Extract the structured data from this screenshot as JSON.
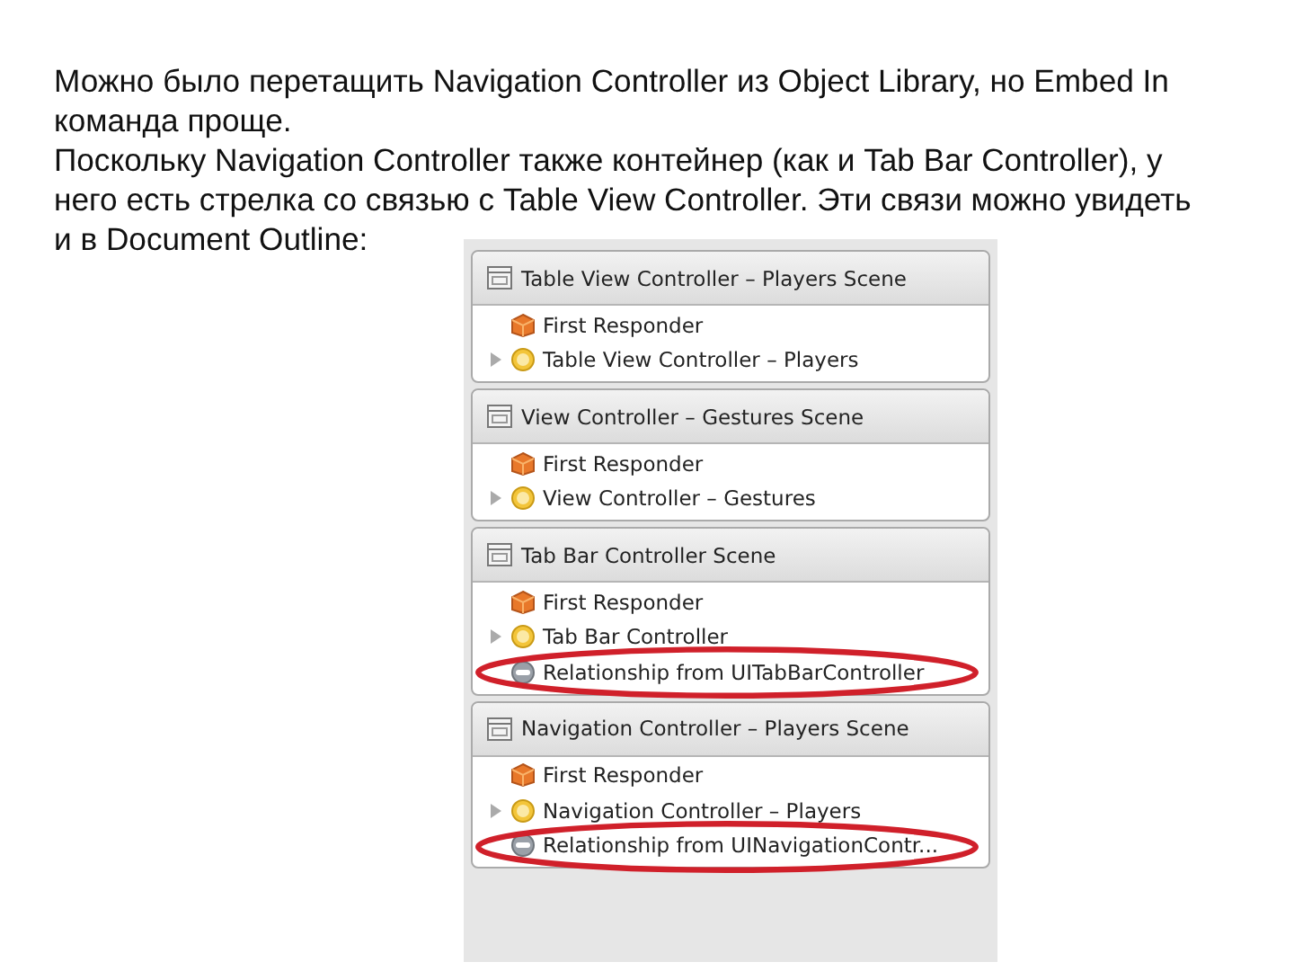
{
  "paragraphs": [
    "Можно было перетащить Navigation Controller из Object Library, но Embed In команда проще.",
    "Поскольку Navigation Controller также контейнер (как и Tab Bar Controller), у него есть стрелка со связью с Table View Controller. Эти связи можно увидеть и в Document Outline:"
  ],
  "outline": {
    "scenes": [
      {
        "title": "Table View Controller – Players Scene",
        "items": [
          {
            "kind": "responder",
            "label": "First Responder"
          },
          {
            "kind": "controller",
            "label": "Table View Controller – Players",
            "expanded": false
          }
        ]
      },
      {
        "title": "View Controller – Gestures Scene",
        "items": [
          {
            "kind": "responder",
            "label": "First Responder"
          },
          {
            "kind": "controller",
            "label": "View Controller – Gestures",
            "expanded": false
          }
        ]
      },
      {
        "title": "Tab Bar Controller Scene",
        "items": [
          {
            "kind": "responder",
            "label": "First Responder"
          },
          {
            "kind": "controller",
            "label": "Tab Bar Controller",
            "expanded": false
          },
          {
            "kind": "relationship",
            "label": "Relationship from UITabBarController",
            "highlighted": true
          }
        ]
      },
      {
        "title": "Navigation Controller – Players Scene",
        "items": [
          {
            "kind": "responder",
            "label": "First Responder"
          },
          {
            "kind": "controller",
            "label": "Navigation Controller – Players",
            "expanded": false
          },
          {
            "kind": "relationship",
            "label": "Relationship from UINavigationContr...",
            "highlighted": true
          }
        ]
      }
    ]
  }
}
